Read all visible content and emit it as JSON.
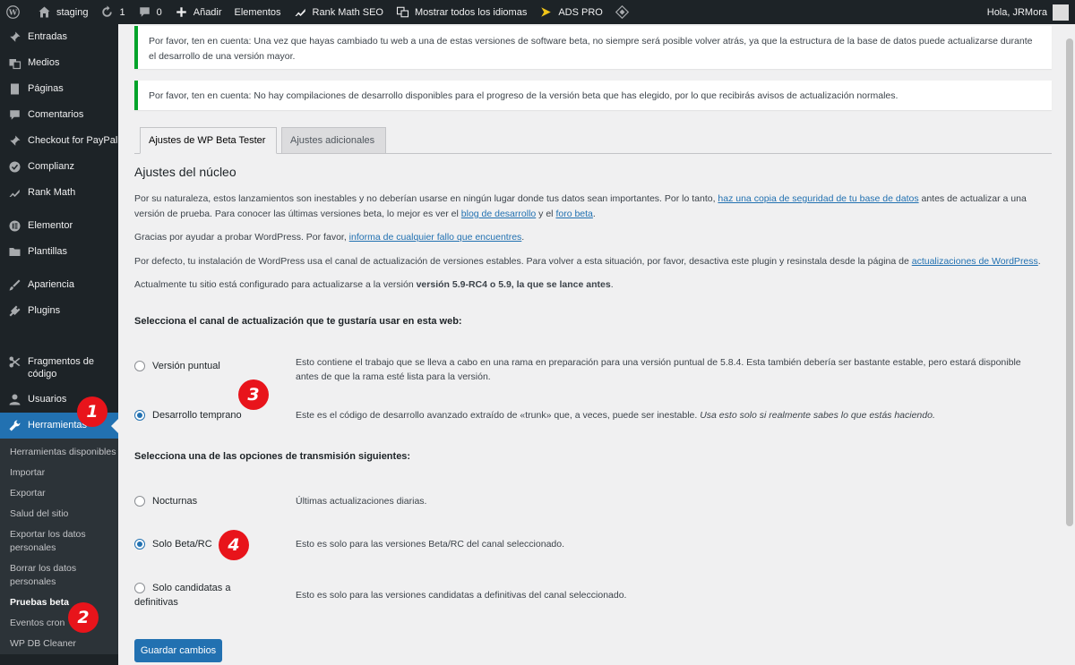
{
  "adminbar": {
    "site_name": "staging",
    "updates_count": "1",
    "comments_count": "0",
    "add_new": "Añadir",
    "elementor": "Elementos",
    "rank_math": "Rank Math SEO",
    "languages": "Mostrar todos los idiomas",
    "ads_pro": "ADS PRO",
    "greeting": "Hola, JRMora"
  },
  "sidebar": {
    "items": [
      {
        "label": "Entradas"
      },
      {
        "label": "Medios"
      },
      {
        "label": "Páginas"
      },
      {
        "label": "Comentarios"
      },
      {
        "label": "Checkout for PayPal"
      },
      {
        "label": "Complianz"
      },
      {
        "label": "Rank Math"
      },
      {
        "label": "Elementor"
      },
      {
        "label": "Plantillas"
      },
      {
        "label": "Apariencia"
      },
      {
        "label": "Plugins"
      },
      {
        "label": "Fragmentos de código"
      },
      {
        "label": "Usuarios"
      },
      {
        "label": "Herramientas"
      }
    ],
    "submenu": [
      "Herramientas disponibles",
      "Importar",
      "Exportar",
      "Salud del sitio",
      "Exportar los datos personales",
      "Borrar los datos personales",
      "Pruebas beta",
      "Eventos cron",
      "WP DB Cleaner"
    ]
  },
  "notices": {
    "notice1_lead": "Por favor, ten en cuenta:",
    "notice1_text": " Una vez que hayas cambiado tu web a una de estas versiones de software beta, no siempre será posible volver atrás, ya que la estructura de la base de datos puede actualizarse durante el desarrollo de una versión mayor.",
    "notice2_lead": "Por favor, ten en cuenta:",
    "notice2_text": " No hay compilaciones de desarrollo disponibles para el progreso de la versión beta que has elegido, por lo que recibirás avisos de actualización normales."
  },
  "tabs": {
    "tab1": "Ajustes de WP Beta Tester",
    "tab2": "Ajustes adicionales"
  },
  "main": {
    "heading": "Ajustes del núcleo",
    "p1_a": "Por su naturaleza, estos lanzamientos son inestables y no deberían usarse en ningún lugar donde tus datos sean importantes. Por lo tanto, ",
    "p1_link1": "haz una copia de seguridad de tu base de datos",
    "p1_b": " antes de actualizar a una versión de prueba. Para conocer las últimas versiones beta, lo mejor es ver el ",
    "p1_link2": "blog de desarrollo",
    "p1_c": " y el ",
    "p1_link3": "foro beta",
    "p1_d": ".",
    "p2_a": "Gracias por ayudar a probar WordPress. Por favor, ",
    "p2_link": "informa de cualquier fallo que encuentres",
    "p2_b": ".",
    "p3_a": "Por defecto, tu instalación de WordPress usa el canal de actualización de versiones estables. Para volver a esta situación, por favor, desactiva este plugin y resinstala desde la página de ",
    "p3_link": "actualizaciones de WordPress",
    "p3_b": ".",
    "p4_a": "Actualmente tu sitio está configurado para actualizarse a la versión ",
    "p4_strong": "versión 5.9-RC4 o 5.9, la que se lance antes",
    "p4_b": ".",
    "channel_label": "Selecciona el canal de actualización que te gustaría usar en esta web:",
    "stream_label": "Selecciona una de las opciones de transmisión siguientes:",
    "save": "Guardar cambios"
  },
  "channels": [
    {
      "label": "Versión puntual",
      "desc": "Esto contiene el trabajo que se lleva a cabo en una rama en preparación para una versión puntual de 5.8.4. Esta también debería ser bastante estable, pero estará disponible antes de que la rama esté lista para la versión.",
      "checked": false
    },
    {
      "label": "Desarrollo temprano",
      "desc_a": "Este es el código de desarrollo avanzado extraído de «trunk» que, a veces, puede ser inestable. ",
      "desc_em": "Usa esto solo si realmente sabes lo que estás haciendo.",
      "checked": true
    }
  ],
  "streams": [
    {
      "label": "Nocturnas",
      "desc": "Últimas actualizaciones diarias.",
      "checked": false
    },
    {
      "label": "Solo Beta/RC",
      "desc": "Esto es solo para las versiones Beta/RC del canal seleccionado.",
      "checked": true
    },
    {
      "label_line1": "Solo candidatas a",
      "label_line2": "definitivas",
      "desc": "Esto es solo para las versiones candidatas a definitivas del canal seleccionado.",
      "checked": false
    }
  ],
  "markers": [
    "1",
    "2",
    "3",
    "4"
  ],
  "accent_color": "#2271b1",
  "marker_color": "#e8141b"
}
